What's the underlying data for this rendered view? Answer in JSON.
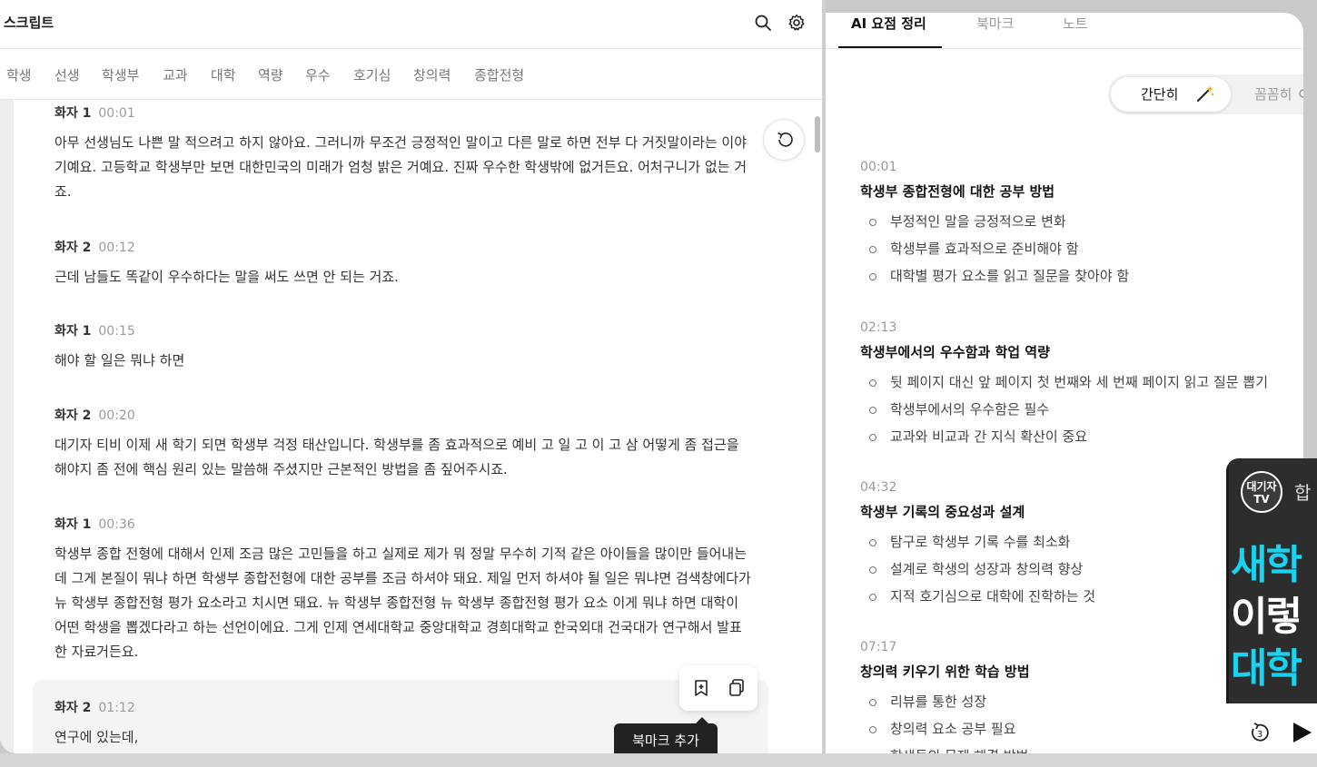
{
  "left_panel": {
    "title": "스크립트",
    "tags": [
      "학생",
      "선생",
      "학생부",
      "교과",
      "대학",
      "역량",
      "우수",
      "호기심",
      "창의력",
      "종합전형"
    ],
    "segments": [
      {
        "speaker": "화자 1",
        "time": "00:01",
        "text": "아무 선생님도 나쁜 말 적으려고 하지 않아요. 그러니까 무조건 긍정적인 말이고 다른 말로 하면 전부 다 거짓말이라는 이야기예요. 고등학교 학생부만 보면 대한민국의 미래가 엄청 밝은 거예요. 진짜 우수한 학생밖에 없거든요. 어처구니가 없는 거죠."
      },
      {
        "speaker": "화자 2",
        "time": "00:12",
        "text": "근데 남들도 똑같이 우수하다는 말을 써도 쓰면 안 되는 거죠."
      },
      {
        "speaker": "화자 1",
        "time": "00:15",
        "text": "해야 할 일은 뭐냐 하면"
      },
      {
        "speaker": "화자 2",
        "time": "00:20",
        "text": "대기자 티비 이제 새 학기 되면 학생부 걱정 태산입니다. 학생부를 좀 효과적으로 예비 고 일 고 이 고 삼 어떻게 좀 접근을 해야지 좀 전에 핵심 원리 있는 말씀해 주셨지만 근본적인 방법을 좀 짚어주시죠."
      },
      {
        "speaker": "화자 1",
        "time": "00:36",
        "text": "학생부 종합 전형에 대해서 인제 조금 많은 고민들을 하고 실제로 제가 뭐 정말 무수히 기적 같은 아이들을 많이만 들어내는데 그게 본질이 뭐냐 하면 학생부 종합전형에 대한 공부를 조금 하셔야 돼요. 제일 먼저 하셔야 될 일은 뭐냐면 검색창에다가 뉴 학생부 종합전형 평가 요소라고 치시면 돼요. 뉴 학생부 종합전형 뉴 학생부 종합전형 평가 요소 이게 뭐냐 하면 대학이 어떤 학생을 뽑겠다라고 하는 선언이에요. 그게 인제 연세대학교 중앙대학교 경희대학교 한국외대 건국대가 연구해서 발표한 자료거든요."
      },
      {
        "speaker": "화자 2",
        "time": "01:12",
        "text": "연구에 있는데,"
      }
    ],
    "tooltip": "북마크 추가"
  },
  "right_panel": {
    "tabs": [
      "AI 요점 정리",
      "북마크",
      "노트"
    ],
    "toggle": {
      "simple": "간단히",
      "detailed": "꼼꼼히"
    },
    "summaries": [
      {
        "time": "00:01",
        "title": "학생부 종합전형에 대한 공부 방법",
        "points": [
          "부정적인 말을 긍정적으로 변화",
          "학생부를 효과적으로 준비해야 함",
          "대학별 평가 요소를 읽고 질문을 찾아야 함"
        ]
      },
      {
        "time": "02:13",
        "title": "학생부에서의 우수함과 학업 역량",
        "points": [
          "뒷 페이지 대신 앞 페이지 첫 번째와 세 번째 페이지 읽고 질문 뽑기",
          "학생부에서의 우수함은 필수",
          "교과와 비교과 간 지식 확산이 중요"
        ]
      },
      {
        "time": "04:32",
        "title": "학생부 기록의 중요성과 설계",
        "points": [
          "탐구로 학생부 기록 수를 최소화",
          "설계로 학생의 성장과 창의력 향상",
          "지적 호기심으로 대학에 진학하는 것"
        ]
      },
      {
        "time": "07:17",
        "title": "창의력 키우기 위한 학습 방법",
        "points": [
          "리뷰를 통한 성장",
          "창의력 요소 공부 필요",
          "학생들의 문제 해결 방법"
        ]
      }
    ]
  },
  "video": {
    "logo_text": "대기자TV",
    "heading_fragment": "합",
    "thumb_lines": [
      "새학",
      "이렇",
      "대학"
    ],
    "rewind_seconds": "3"
  },
  "colors": {
    "accent_cyan": "#19d3f0",
    "thumb_white": "#ffffff"
  }
}
